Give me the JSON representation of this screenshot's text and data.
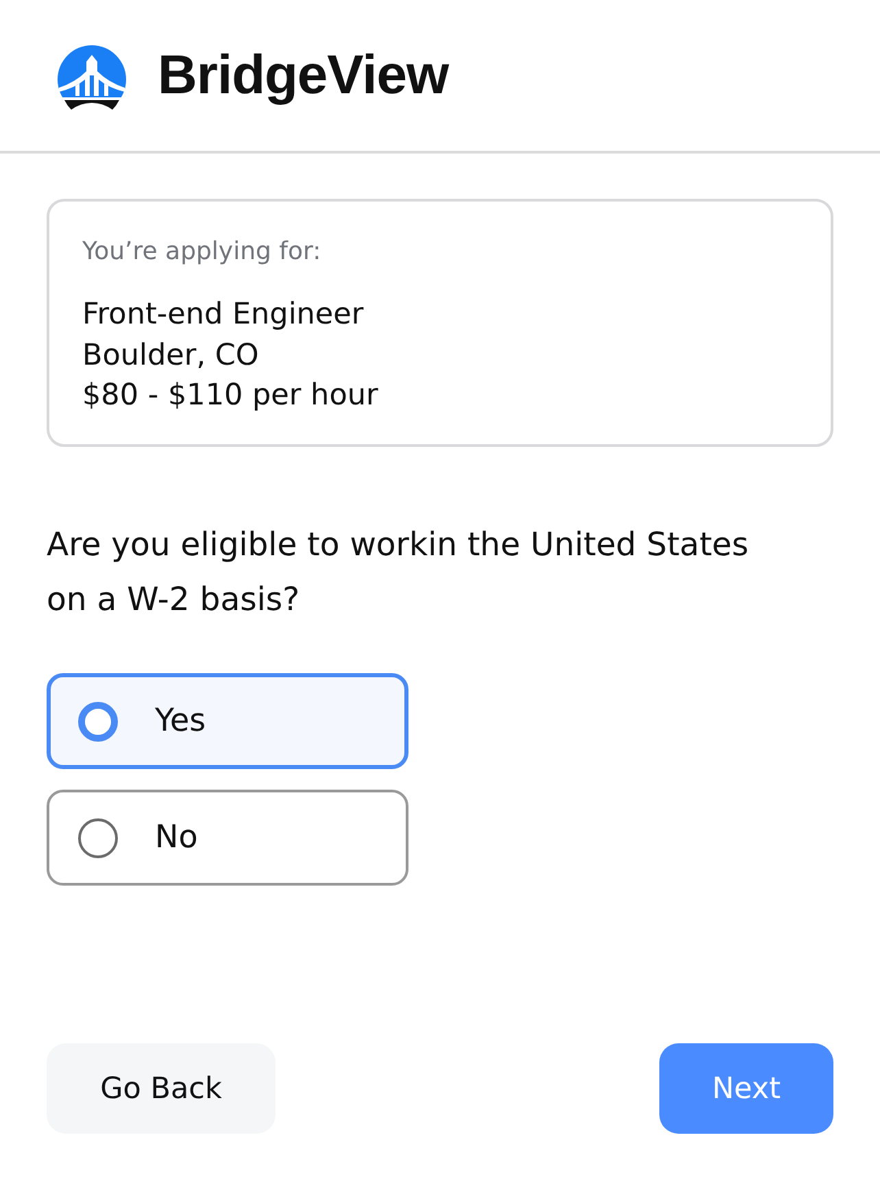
{
  "header": {
    "brand": "BridgeView"
  },
  "job_card": {
    "label": "You’re applying for:",
    "title": "Front-end Engineer",
    "location": "Boulder, CO",
    "pay": "$80 - $110 per hour"
  },
  "question": {
    "text": "Are you eligible to workin the United States on a W-2 basis?",
    "options": [
      {
        "label": "Yes",
        "selected": true
      },
      {
        "label": "No",
        "selected": false
      }
    ]
  },
  "buttons": [
    {
      "label": "Go Back",
      "kind": "secondary"
    },
    {
      "label": "Next",
      "kind": "primary"
    }
  ]
}
